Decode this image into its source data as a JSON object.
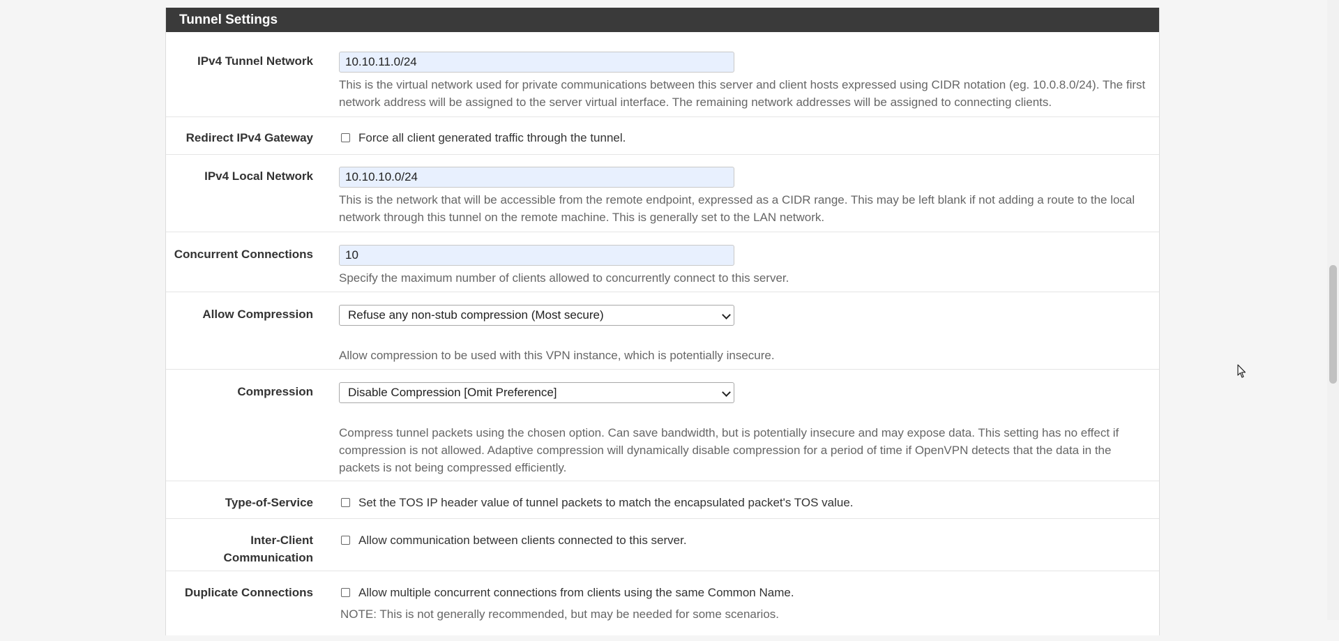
{
  "section": {
    "title": "Tunnel Settings"
  },
  "rows": {
    "ipv4_tunnel_network": {
      "label": "IPv4 Tunnel Network",
      "value": "10.10.11.0/24",
      "help": "This is the virtual network used for private communications between this server and client hosts expressed using CIDR notation (eg. 10.0.8.0/24). The first network address will be assigned to the server virtual interface. The remaining network addresses will be assigned to connecting clients."
    },
    "redirect_ipv4_gateway": {
      "label": "Redirect IPv4 Gateway",
      "checkbox_label": "Force all client generated traffic through the tunnel.",
      "checked": false
    },
    "ipv4_local_network": {
      "label": "IPv4 Local Network",
      "value": "10.10.10.0/24",
      "help": "This is the network that will be accessible from the remote endpoint, expressed as a CIDR range. This may be left blank if not adding a route to the local network through this tunnel on the remote machine. This is generally set to the LAN network."
    },
    "concurrent_connections": {
      "label": "Concurrent Connections",
      "value": "10",
      "help": "Specify the maximum number of clients allowed to concurrently connect to this server."
    },
    "allow_compression": {
      "label": "Allow Compression",
      "selected": "Refuse any non-stub compression (Most secure)",
      "help": "Allow compression to be used with this VPN instance, which is potentially insecure."
    },
    "compression": {
      "label": "Compression",
      "selected": "Disable Compression [Omit Preference]",
      "help": "Compress tunnel packets using the chosen option. Can save bandwidth, but is potentially insecure and may expose data. This setting has no effect if compression is not allowed. Adaptive compression will dynamically disable compression for a period of time if OpenVPN detects that the data in the packets is not being compressed efficiently."
    },
    "type_of_service": {
      "label": "Type-of-Service",
      "checkbox_label": "Set the TOS IP header value of tunnel packets to match the encapsulated packet's TOS value.",
      "checked": false
    },
    "inter_client": {
      "label_line1": "Inter-Client",
      "label_line2": "Communication",
      "checkbox_label": "Allow communication between clients connected to this server.",
      "checked": false
    },
    "duplicate_connections": {
      "label": "Duplicate Connections",
      "checkbox_label": "Allow multiple concurrent connections from clients using the same Common Name.",
      "note": "NOTE: This is not generally recommended, but may be needed for some scenarios.",
      "checked": false
    }
  },
  "icons": {
    "select_arrow": "chevron-down-icon",
    "cursor": "mouse-pointer-icon"
  },
  "colors": {
    "heading_bg": "#3a3a3a",
    "input_bg": "#e8f0fe",
    "help_text": "#666666"
  }
}
